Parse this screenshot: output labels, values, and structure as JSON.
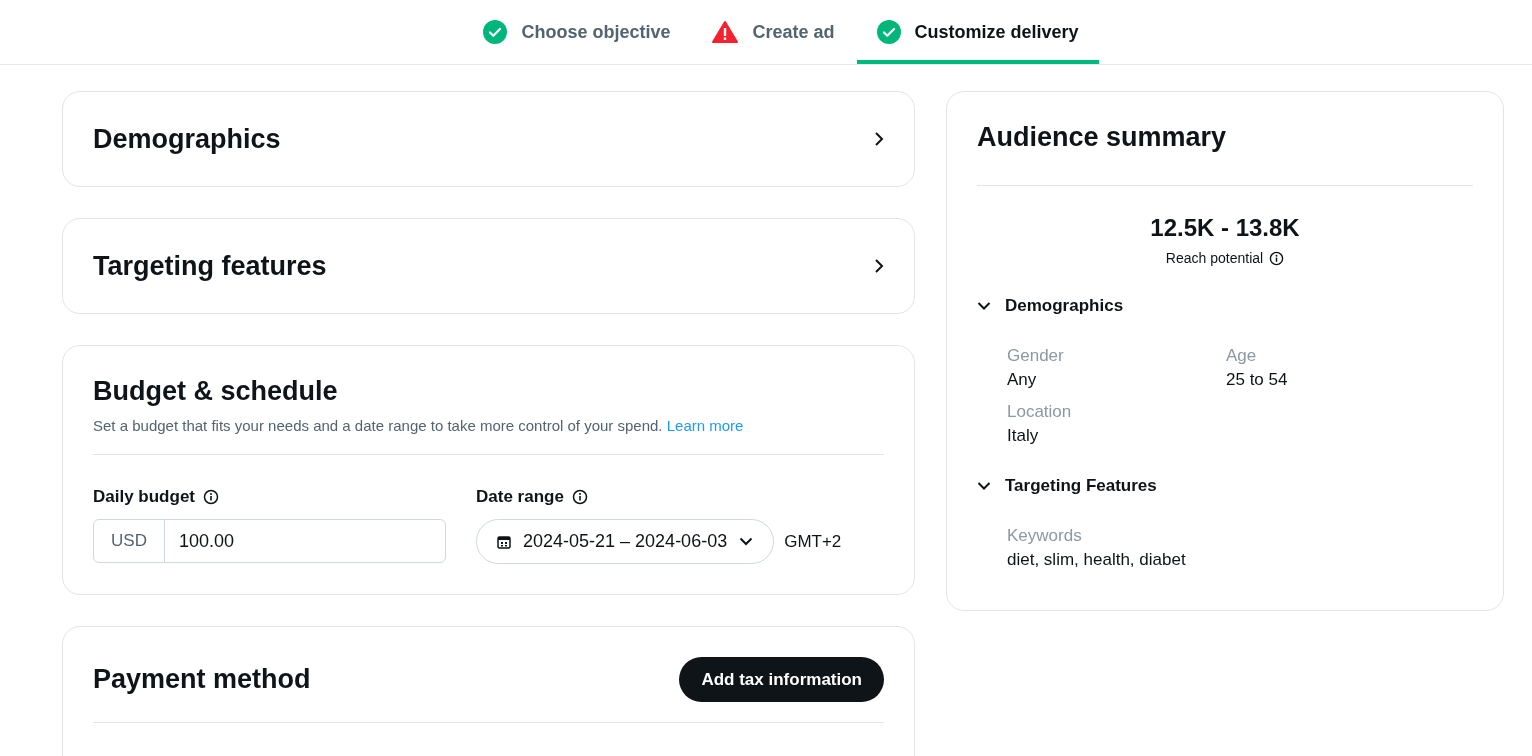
{
  "steps": [
    {
      "label": "Choose objective",
      "kind": "done",
      "selected": false
    },
    {
      "label": "Create ad",
      "kind": "error",
      "selected": false
    },
    {
      "label": "Customize delivery",
      "kind": "done",
      "selected": true
    }
  ],
  "sections": [
    {
      "title": "Demographics"
    },
    {
      "title": "Targeting features"
    }
  ],
  "budget": {
    "title": "Budget & schedule",
    "description": "Set a budget that fits your needs and a date range to take more control of your spend.",
    "link": "Learn more",
    "daily_budget": {
      "label": "Daily budget",
      "currency": "USD",
      "value": "100.00"
    },
    "date_range": {
      "label": "Date range",
      "value": "2024-05-21 – 2024-06-03",
      "timezone": "GMT+2"
    }
  },
  "payment": {
    "title": "Payment method",
    "button": "Add tax information"
  },
  "summary": {
    "title": "Audience summary",
    "reach": "12.5K - 13.8K",
    "reach_label": "Reach potential",
    "groups": [
      {
        "title": "Demographics",
        "expanded": true,
        "fields": [
          {
            "label": "Gender",
            "value": "Any"
          },
          {
            "label": "Age",
            "value": "25 to 54"
          },
          {
            "label": "Location",
            "value": "Italy"
          }
        ]
      },
      {
        "title": "Targeting Features",
        "expanded": true,
        "fields": [
          {
            "label": "Keywords",
            "value": "diet, slim, health, diabet"
          }
        ]
      }
    ]
  }
}
